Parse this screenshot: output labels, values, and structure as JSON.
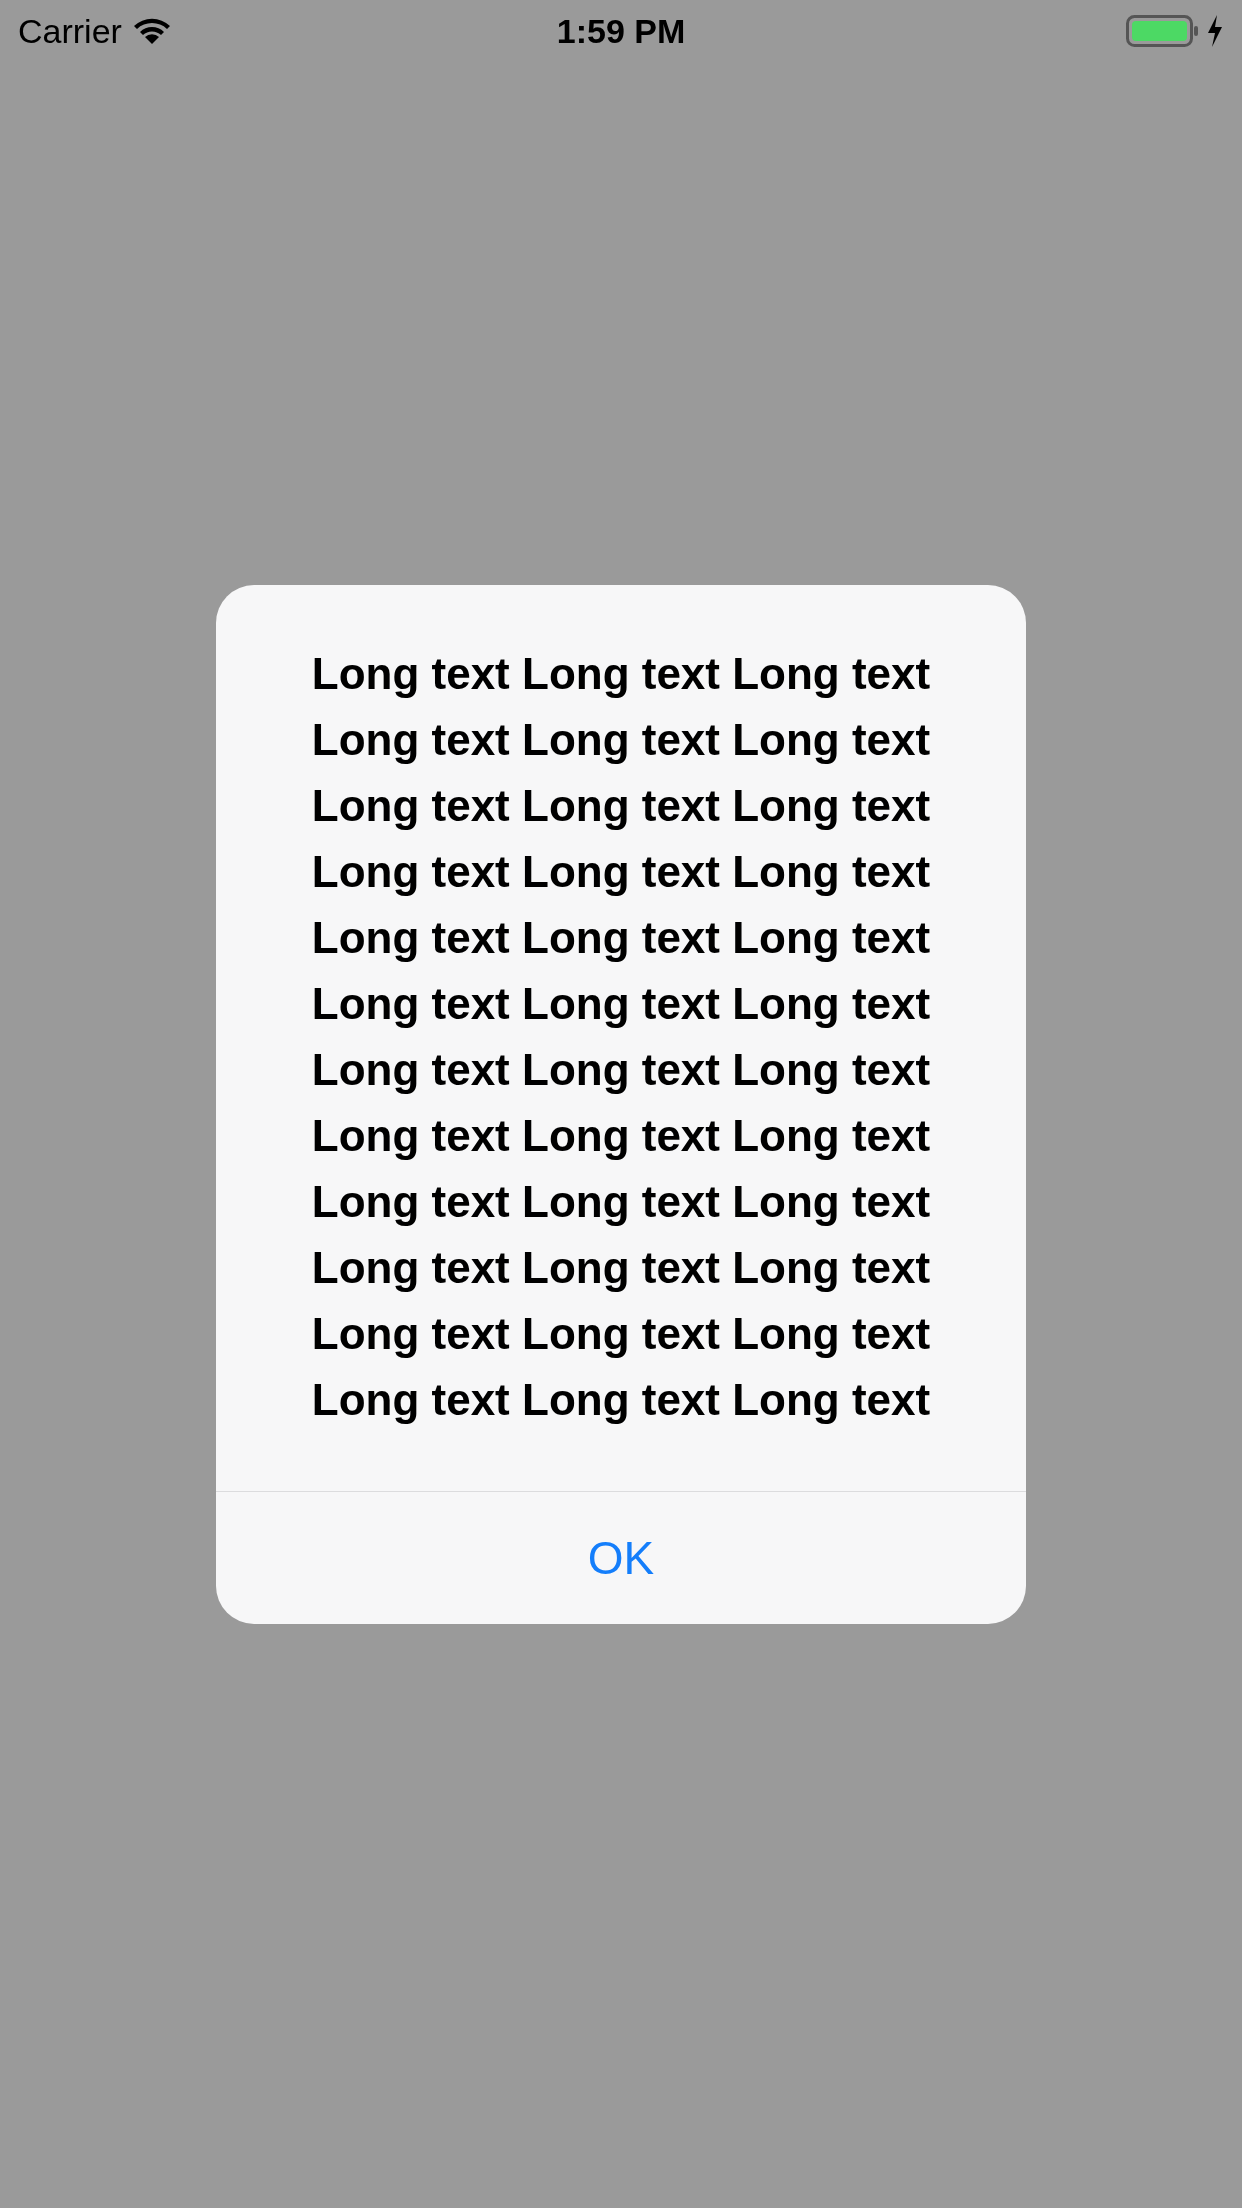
{
  "status_bar": {
    "carrier": "Carrier",
    "time": "1:59 PM",
    "charging": true
  },
  "alert": {
    "message": "Long text Long text Long text Long text Long text Long text Long text Long text Long text Long text Long text Long text Long text Long text Long text Long text Long text Long text Long text Long text Long text Long text Long text Long text Long text Long text Long text Long text Long text Long text Long text Long text Long text Long text Long text Long text",
    "buttons": [
      "OK"
    ]
  }
}
